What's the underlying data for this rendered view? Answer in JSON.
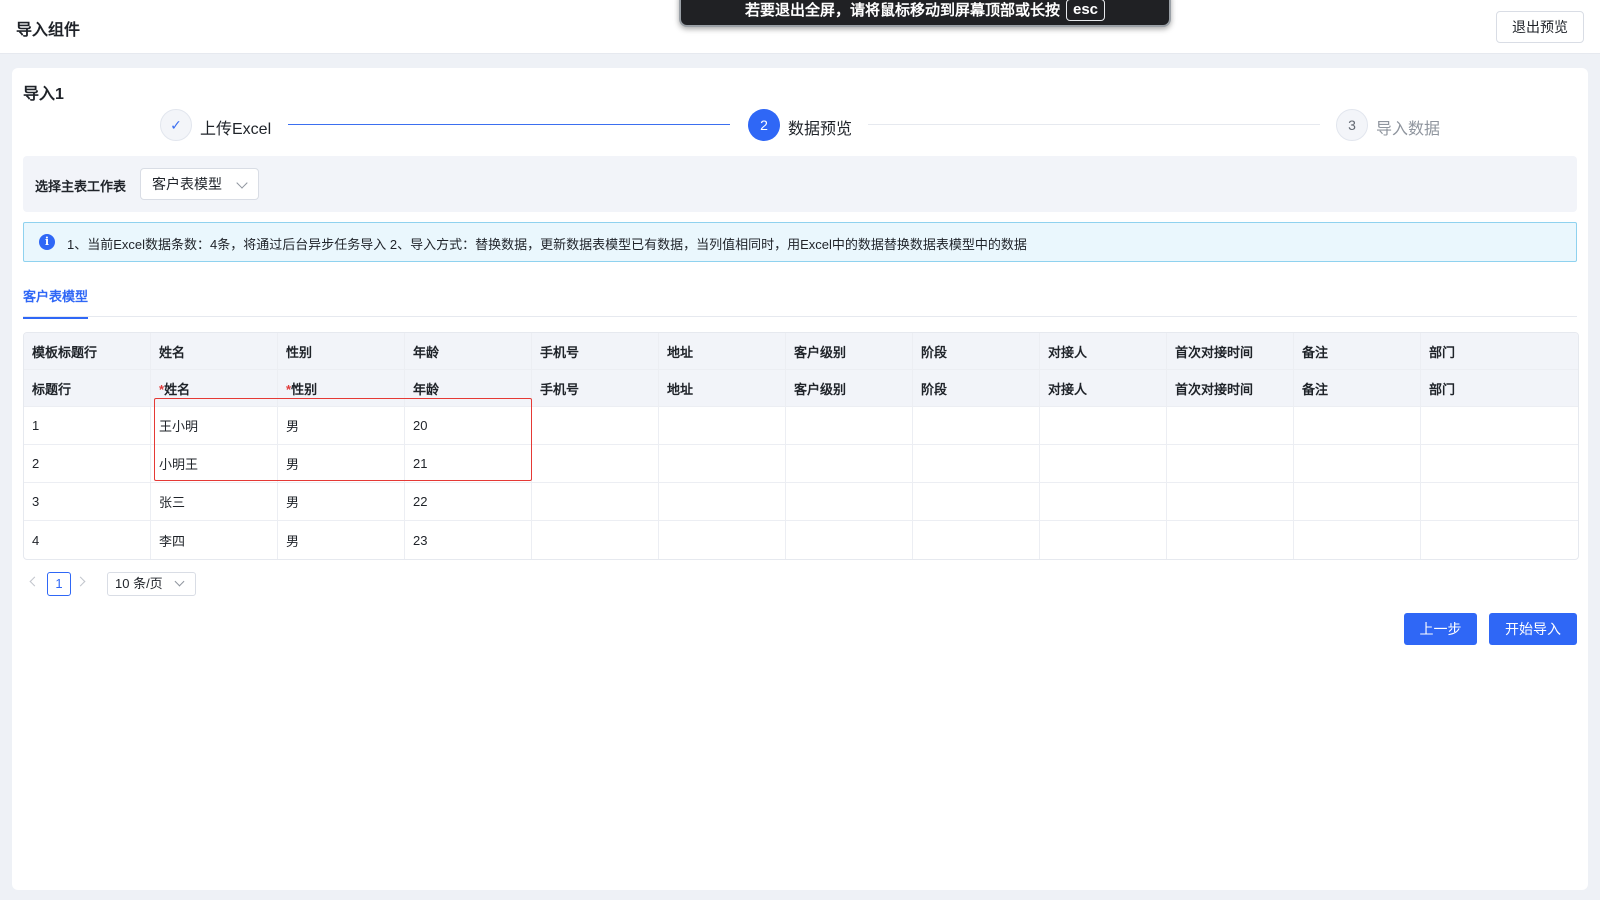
{
  "header": {
    "title": "导入组件",
    "exit_preview": "退出预览"
  },
  "fullscreen_toast": {
    "text": "若要退出全屏，请将鼠标移动到屏幕顶部或长按",
    "key": "esc"
  },
  "card": {
    "title": "导入1"
  },
  "steps": [
    {
      "label": "上传Excel",
      "marker": "✓",
      "state": "done"
    },
    {
      "label": "数据预览",
      "marker": "2",
      "state": "active"
    },
    {
      "label": "导入数据",
      "marker": "3",
      "state": "pending"
    }
  ],
  "sheet_selector": {
    "label": "选择主表工作表",
    "value": "客户表模型"
  },
  "alert": {
    "text": "1、当前Excel数据条数：4条，将通过后台异步任务导入   2、导入方式：替换数据，更新数据表模型已有数据，当列值相同时，用Excel中的数据替换数据表模型中的数据"
  },
  "tabs": [
    {
      "label": "客户表模型",
      "active": true
    }
  ],
  "table": {
    "header_row_1": [
      "模板标题行",
      "姓名",
      "性别",
      "年龄",
      "手机号",
      "地址",
      "客户级别",
      "阶段",
      "对接人",
      "首次对接时间",
      "备注",
      "部门"
    ],
    "header_row_2": [
      {
        "text": "标题行",
        "required": false
      },
      {
        "text": "姓名",
        "required": true
      },
      {
        "text": "性别",
        "required": true
      },
      {
        "text": "年龄",
        "required": false
      },
      {
        "text": "手机号",
        "required": false
      },
      {
        "text": "地址",
        "required": false
      },
      {
        "text": "客户级别",
        "required": false
      },
      {
        "text": "阶段",
        "required": false
      },
      {
        "text": "对接人",
        "required": false
      },
      {
        "text": "首次对接时间",
        "required": false
      },
      {
        "text": "备注",
        "required": false
      },
      {
        "text": "部门",
        "required": false
      }
    ],
    "rows": [
      [
        "1",
        "王小明",
        "男",
        "20",
        "",
        "",
        "",
        "",
        "",
        "",
        "",
        ""
      ],
      [
        "2",
        "小明王",
        "男",
        "21",
        "",
        "",
        "",
        "",
        "",
        "",
        "",
        ""
      ],
      [
        "3",
        "张三",
        "男",
        "22",
        "",
        "",
        "",
        "",
        "",
        "",
        "",
        ""
      ],
      [
        "4",
        "李四",
        "男",
        "23",
        "",
        "",
        "",
        "",
        "",
        "",
        "",
        ""
      ]
    ]
  },
  "pagination": {
    "current_page": "1",
    "page_size": "10 条/页"
  },
  "actions": {
    "prev": "上一步",
    "start": "开始导入"
  },
  "colors": {
    "primary": "#2f67f6",
    "required": "#e03b3b",
    "highlight": "#e53935",
    "alert_bg": "#eaf7fd"
  }
}
